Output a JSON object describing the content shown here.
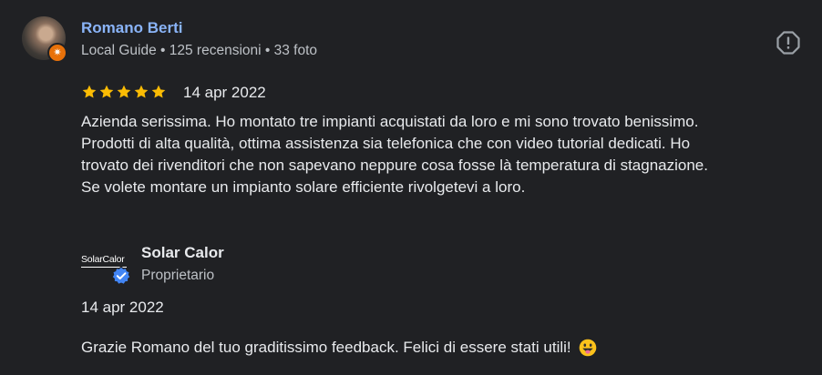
{
  "review": {
    "author": {
      "name": "Romano Berti",
      "meta": "Local Guide • 125 recensioni • 33 foto",
      "badge_icon": "local-guide-star-icon",
      "badge_color": "#e8710a"
    },
    "rating": 5,
    "rating_max": 5,
    "date": "14 apr 2022",
    "text_lines": [
      "Azienda serissima. Ho montato tre impianti acquistati da loro e mi sono trovato benissimo.",
      "Prodotti di alta qualità, ottima assistenza sia telefonica che con video tutorial dedicati. Ho",
      "trovato dei rivenditori che non sapevano neppure cosa fosse là temperatura di stagnazione.",
      "Se volete montare un impianto solare efficiente rivolgetevi a loro."
    ],
    "report_icon": "report-icon"
  },
  "owner_reply": {
    "logo_text": "SolarCalor",
    "name": "Solar Calor",
    "role": "Proprietario",
    "verified_icon": "verified-check-icon",
    "date": "14 apr 2022",
    "text": "Grazie Romano del tuo graditissimo feedback. Felici di essere stati utili!",
    "emoji_icon": "grinning-tongue-emoji-icon"
  },
  "colors": {
    "background": "#202124",
    "author_link": "#8ab4f8",
    "star": "#fbbc04",
    "verified": "#4285f4"
  }
}
